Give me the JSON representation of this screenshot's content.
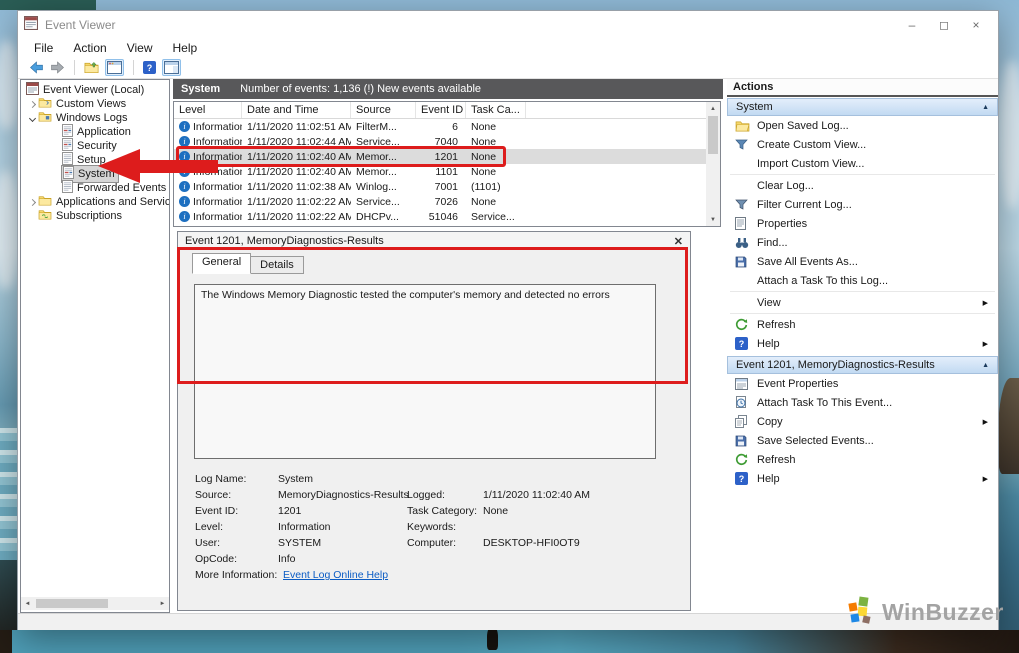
{
  "colors": {
    "annotation_red": "#dd1c1c",
    "summary_bar_bg": "#58585a",
    "section_header_blue": "#c2daf2",
    "link_blue": "#0b5cc4",
    "info_icon_blue": "#1d6fc0",
    "selection_gray": "#dcdcdc"
  },
  "window": {
    "title": "Event Viewer",
    "controls": {
      "minimize": "–",
      "maximize": "◻",
      "close": "×"
    }
  },
  "menu": {
    "items": [
      "File",
      "Action",
      "View",
      "Help"
    ]
  },
  "tree": {
    "items": [
      {
        "label": "Event Viewer (Local)"
      },
      {
        "label": "Custom Views"
      },
      {
        "label": "Windows Logs"
      },
      {
        "label": "Application"
      },
      {
        "label": "Security"
      },
      {
        "label": "Setup"
      },
      {
        "label": "System"
      },
      {
        "label": "Forwarded Events"
      },
      {
        "label": "Applications and Services Lo"
      },
      {
        "label": "Subscriptions"
      }
    ]
  },
  "events_panel": {
    "log_name": "System",
    "summary": "Number of events: 1,136 (!) New events available",
    "columns": [
      "Level",
      "Date and Time",
      "Source",
      "Event ID",
      "Task Ca..."
    ],
    "rows": [
      {
        "level": "Information",
        "datetime": "1/11/2020 11:02:51 AM",
        "source": "FilterM...",
        "event_id": "6",
        "task": "None"
      },
      {
        "level": "Information",
        "datetime": "1/11/2020 11:02:44 AM",
        "source": "Service...",
        "event_id": "7040",
        "task": "None"
      },
      {
        "level": "Information",
        "datetime": "1/11/2020 11:02:40 AM",
        "source": "Memor...",
        "event_id": "1201",
        "task": "None"
      },
      {
        "level": "Information",
        "datetime": "1/11/2020 11:02:40 AM",
        "source": "Memor...",
        "event_id": "1101",
        "task": "None"
      },
      {
        "level": "Information",
        "datetime": "1/11/2020 11:02:38 AM",
        "source": "Winlog...",
        "event_id": "7001",
        "task": "(1101)"
      },
      {
        "level": "Information",
        "datetime": "1/11/2020 11:02:22 AM",
        "source": "Service...",
        "event_id": "7026",
        "task": "None"
      },
      {
        "level": "Information",
        "datetime": "1/11/2020 11:02:22 AM",
        "source": "DHCPv...",
        "event_id": "51046",
        "task": "Service..."
      }
    ]
  },
  "preview": {
    "title": "Event 1201, MemoryDiagnostics-Results",
    "close_glyph": "✕",
    "tabs": [
      "General",
      "Details"
    ],
    "message": "The Windows Memory Diagnostic tested the computer's memory and detected no errors",
    "fields": {
      "log_name_label": "Log Name:",
      "log_name": "System",
      "source_label": "Source:",
      "source": "MemoryDiagnostics-Results",
      "logged_label": "Logged:",
      "logged": "1/11/2020 11:02:40 AM",
      "event_id_label": "Event ID:",
      "event_id": "1201",
      "task_category_label": "Task Category:",
      "task_category": "None",
      "level_label": "Level:",
      "level": "Information",
      "keywords_label": "Keywords:",
      "keywords": "",
      "user_label": "User:",
      "user": "SYSTEM",
      "computer_label": "Computer:",
      "computer": "DESKTOP-HFI0OT9",
      "opcode_label": "OpCode:",
      "opcode": "Info",
      "more_info_label": "More Information:",
      "more_info_link": "Event Log Online Help"
    }
  },
  "actions": {
    "header": "Actions",
    "sections": [
      {
        "title": "System",
        "items": [
          {
            "label": "Open Saved Log..."
          },
          {
            "label": "Create Custom View..."
          },
          {
            "label": "Import Custom View..."
          },
          {
            "label": "Clear Log..."
          },
          {
            "label": "Filter Current Log..."
          },
          {
            "label": "Properties"
          },
          {
            "label": "Find..."
          },
          {
            "label": "Save All Events As..."
          },
          {
            "label": "Attach a Task To this Log..."
          },
          {
            "label": "View"
          },
          {
            "label": "Refresh"
          },
          {
            "label": "Help"
          }
        ]
      },
      {
        "title": "Event 1201, MemoryDiagnostics-Results",
        "items": [
          {
            "label": "Event Properties"
          },
          {
            "label": "Attach Task To This Event..."
          },
          {
            "label": "Copy"
          },
          {
            "label": "Save Selected Events..."
          },
          {
            "label": "Refresh"
          },
          {
            "label": "Help"
          }
        ]
      }
    ]
  },
  "glyphs": {
    "scroll_up": "▲",
    "scroll_down": "▼",
    "scroll_left": "◄",
    "scroll_right": "►",
    "submenu": "▶",
    "collapse": "▲"
  },
  "watermark": {
    "text": "WinBuzzer"
  }
}
